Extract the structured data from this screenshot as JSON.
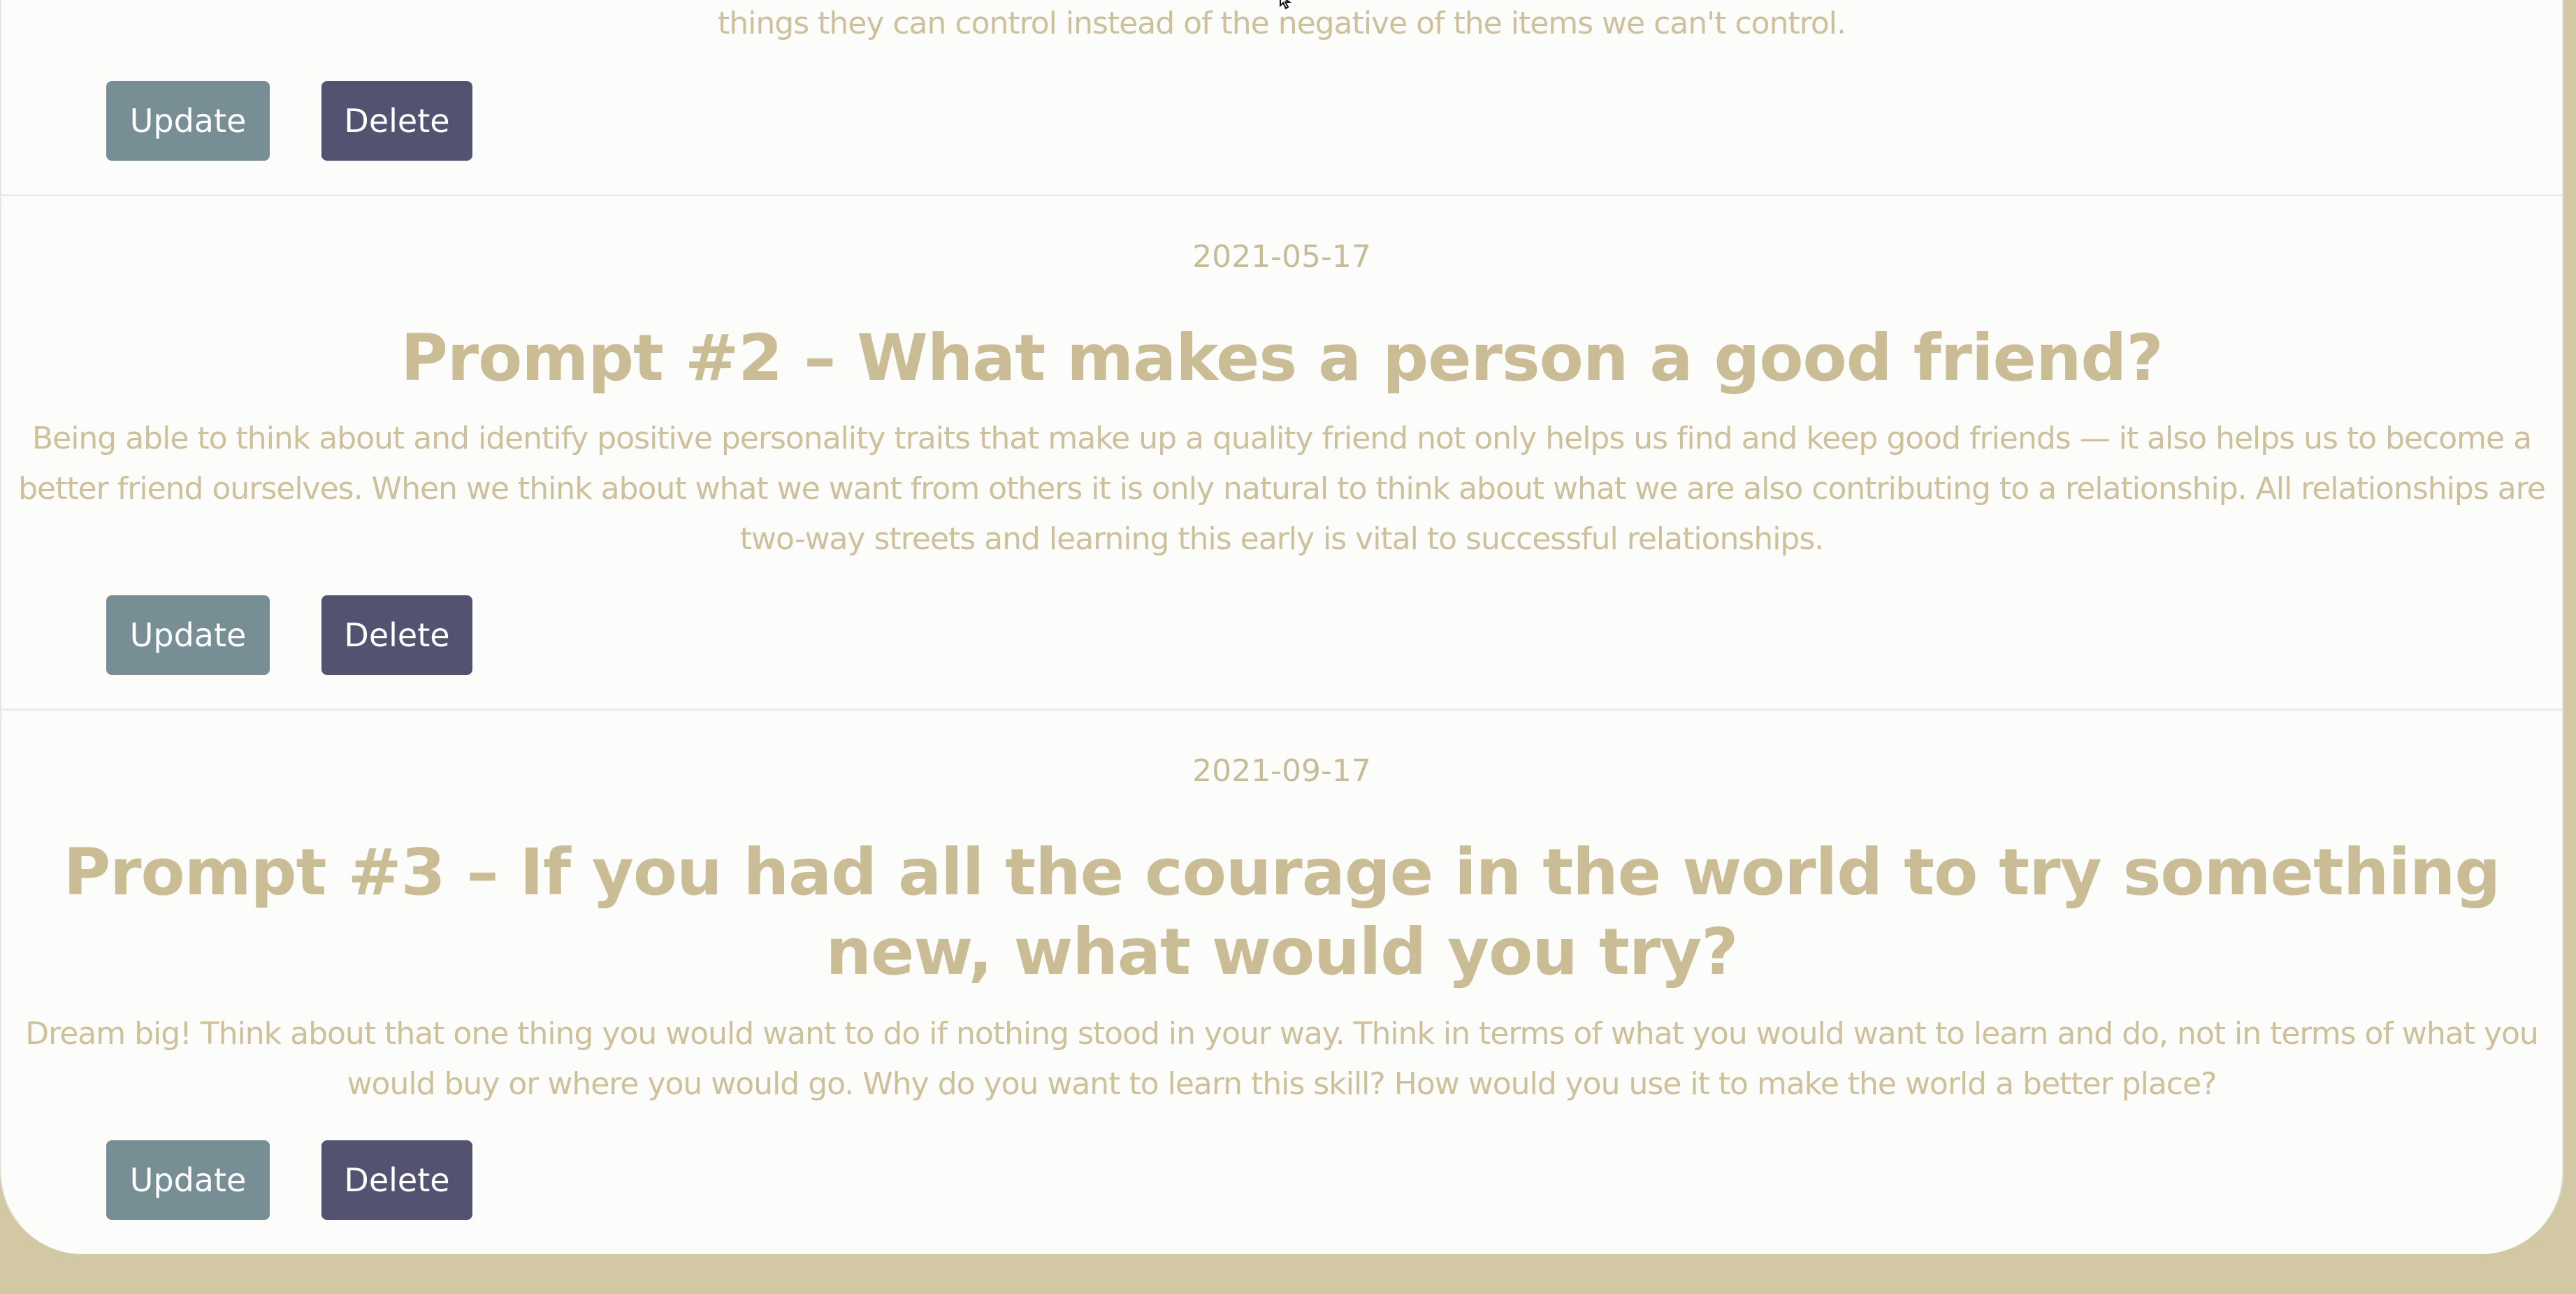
{
  "entries": [
    {
      "date": "",
      "title": "",
      "body": "things they can control instead of the negative of the items we can't control.",
      "update_label": "Update",
      "delete_label": "Delete"
    },
    {
      "date": "2021-05-17",
      "title": "Prompt #2 – What makes a person a good friend?",
      "body": "Being able to think about and identify positive personality traits that make up a quality friend not only helps us find and keep good friends — it also helps us to become a better friend ourselves. When we think about what we want from others it is only natural to think about what we are also contributing to a relationship. All relationships are two-way streets and learning this early is vital to successful relationships.",
      "update_label": "Update",
      "delete_label": "Delete"
    },
    {
      "date": "2021-09-17",
      "title": "Prompt #3 – If you had all the courage in the world to try something new, what would you try?",
      "body": "Dream big! Think about that one thing you would want to do if nothing stood in your way. Think in terms of what you would want to learn and do, not in terms of what you would buy or where you would go. Why do you want to learn this skill? How would you use it to make the world a better place?",
      "update_label": "Update",
      "delete_label": "Delete"
    }
  ],
  "colors": {
    "page_background": "#d3c8a4",
    "card_background": "#fcfcfb",
    "text": "#cdc09a",
    "update_button": "#768e94",
    "delete_button": "#545271"
  },
  "icons": {
    "cursor": "mouse-cursor-icon"
  }
}
